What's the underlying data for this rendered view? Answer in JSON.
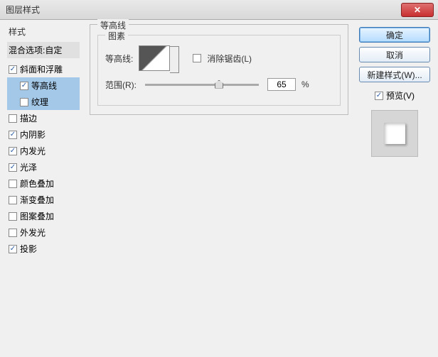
{
  "window": {
    "title": "图层样式"
  },
  "left": {
    "header": "样式",
    "blend": "混合选项:自定",
    "items": [
      {
        "label": "斜面和浮雕",
        "checked": true,
        "selected": false,
        "indent": false
      },
      {
        "label": "等高线",
        "checked": true,
        "selected": true,
        "indent": true
      },
      {
        "label": "纹理",
        "checked": false,
        "selected": true,
        "indent": true
      },
      {
        "label": "描边",
        "checked": false,
        "selected": false,
        "indent": false
      },
      {
        "label": "内阴影",
        "checked": true,
        "selected": false,
        "indent": false
      },
      {
        "label": "内发光",
        "checked": true,
        "selected": false,
        "indent": false
      },
      {
        "label": "光泽",
        "checked": true,
        "selected": false,
        "indent": false
      },
      {
        "label": "颜色叠加",
        "checked": false,
        "selected": false,
        "indent": false
      },
      {
        "label": "渐变叠加",
        "checked": false,
        "selected": false,
        "indent": false
      },
      {
        "label": "图案叠加",
        "checked": false,
        "selected": false,
        "indent": false
      },
      {
        "label": "外发光",
        "checked": false,
        "selected": false,
        "indent": false
      },
      {
        "label": "投影",
        "checked": true,
        "selected": false,
        "indent": false
      }
    ]
  },
  "mid": {
    "section_title": "等高线",
    "subgroup_title": "图素",
    "contour_label": "等高线:",
    "antialias_label": "消除锯齿(L)",
    "antialias_checked": false,
    "range_label": "范围(R):",
    "range_value": "65",
    "range_unit": "%"
  },
  "right": {
    "ok": "确定",
    "cancel": "取消",
    "newstyle": "新建样式(W)...",
    "preview_label": "预览(V)",
    "preview_checked": true
  }
}
